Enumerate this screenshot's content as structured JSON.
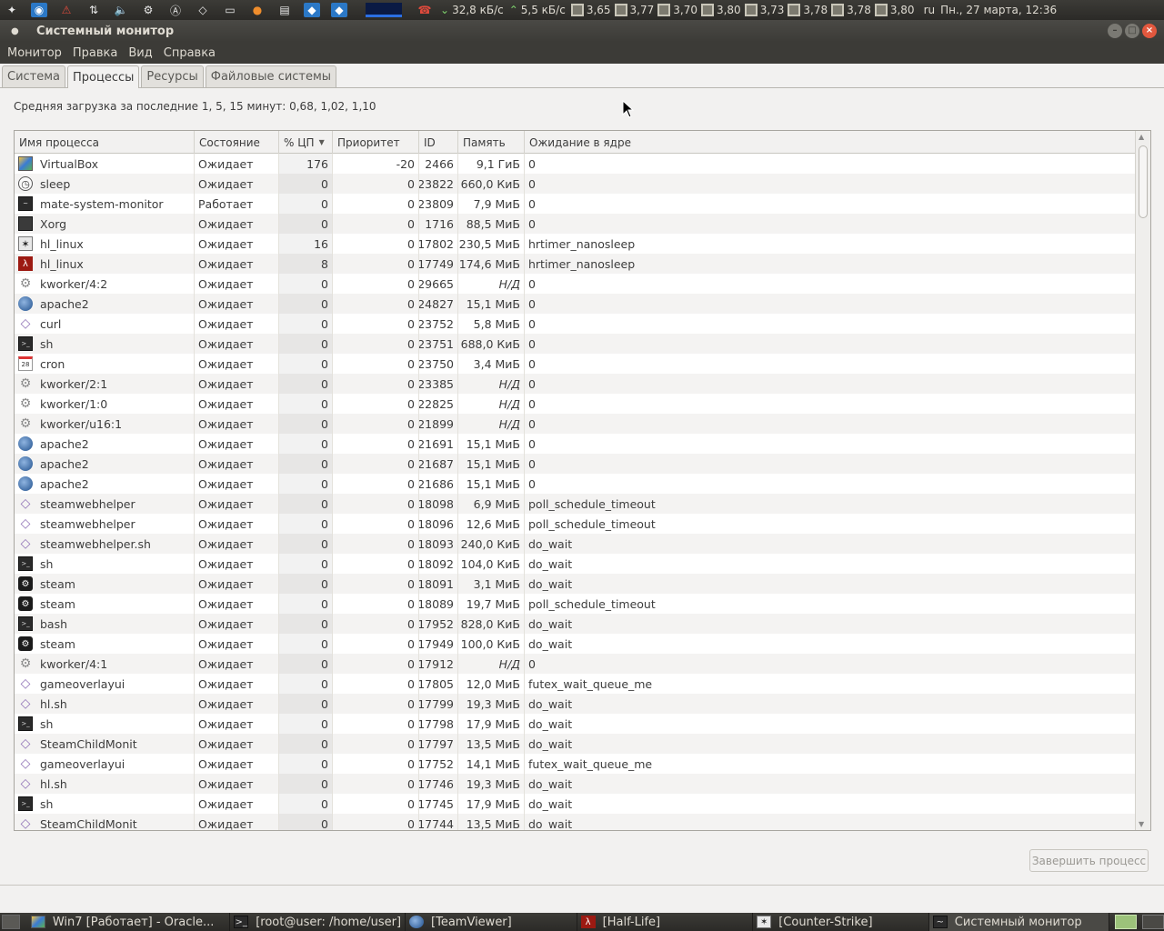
{
  "top_panel": {
    "net_down": "32,8 кБ/с",
    "net_up": "5,5 кБ/с",
    "cpu_freqs": [
      "3,65",
      "3,77",
      "3,70",
      "3,80",
      "3,73",
      "3,78",
      "3,78",
      "3,80"
    ],
    "keyboard_layout": "ru",
    "datetime": "Пн., 27 марта, 12:36"
  },
  "window": {
    "title": "Системный монитор"
  },
  "menu": [
    "Монитор",
    "Правка",
    "Вид",
    "Справка"
  ],
  "tabs": [
    {
      "label": "Система",
      "active": false
    },
    {
      "label": "Процессы",
      "active": true
    },
    {
      "label": "Ресурсы",
      "active": false
    },
    {
      "label": "Файловые системы",
      "active": false
    }
  ],
  "load_avg": "Средняя загрузка за последние 1, 5, 15 минут: 0,68, 1,02, 1,10",
  "table": {
    "columns": [
      "Имя процесса",
      "Состояние",
      "% ЦП",
      "Приоритет",
      "ID",
      "Память",
      "Ожидание в ядре"
    ],
    "sorted_column": "% ЦП",
    "rows": [
      {
        "icon": "virtualbox-icon",
        "name": "VirtualBox",
        "state": "Ожидает",
        "cpu": "176",
        "prio": "-20",
        "id": "2466",
        "mem": "9,1 ГиБ",
        "wait": "0"
      },
      {
        "icon": "clock-icon",
        "name": "sleep",
        "state": "Ожидает",
        "cpu": "0",
        "prio": "0",
        "id": "23822",
        "mem": "660,0 КиБ",
        "wait": "0"
      },
      {
        "icon": "system-monitor-icon",
        "name": "mate-system-monitor",
        "state": "Работает",
        "cpu": "0",
        "prio": "0",
        "id": "23809",
        "mem": "7,9 МиБ",
        "wait": "0"
      },
      {
        "icon": "display-icon",
        "name": "Xorg",
        "state": "Ожидает",
        "cpu": "0",
        "prio": "0",
        "id": "1716",
        "mem": "88,5 МиБ",
        "wait": "0"
      },
      {
        "icon": "counter-strike-icon",
        "name": "hl_linux",
        "state": "Ожидает",
        "cpu": "16",
        "prio": "0",
        "id": "17802",
        "mem": "230,5 МиБ",
        "wait": "hrtimer_nanosleep"
      },
      {
        "icon": "half-life-icon",
        "name": "hl_linux",
        "state": "Ожидает",
        "cpu": "8",
        "prio": "0",
        "id": "17749",
        "mem": "174,6 МиБ",
        "wait": "hrtimer_nanosleep"
      },
      {
        "icon": "gear-icon",
        "name": "kworker/4:2",
        "state": "Ожидает",
        "cpu": "0",
        "prio": "0",
        "id": "29665",
        "mem": "Н/Д",
        "wait": "0"
      },
      {
        "icon": "globe-icon",
        "name": "apache2",
        "state": "Ожидает",
        "cpu": "0",
        "prio": "0",
        "id": "24827",
        "mem": "15,1 МиБ",
        "wait": "0"
      },
      {
        "icon": "diamond-icon",
        "name": "curl",
        "state": "Ожидает",
        "cpu": "0",
        "prio": "0",
        "id": "23752",
        "mem": "5,8 МиБ",
        "wait": "0"
      },
      {
        "icon": "terminal-icon",
        "name": "sh",
        "state": "Ожидает",
        "cpu": "0",
        "prio": "0",
        "id": "23751",
        "mem": "688,0 КиБ",
        "wait": "0"
      },
      {
        "icon": "calendar-icon",
        "name": "cron",
        "state": "Ожидает",
        "cpu": "0",
        "prio": "0",
        "id": "23750",
        "mem": "3,4 МиБ",
        "wait": "0"
      },
      {
        "icon": "gear-icon",
        "name": "kworker/2:1",
        "state": "Ожидает",
        "cpu": "0",
        "prio": "0",
        "id": "23385",
        "mem": "Н/Д",
        "wait": "0"
      },
      {
        "icon": "gear-icon",
        "name": "kworker/1:0",
        "state": "Ожидает",
        "cpu": "0",
        "prio": "0",
        "id": "22825",
        "mem": "Н/Д",
        "wait": "0"
      },
      {
        "icon": "gear-icon",
        "name": "kworker/u16:1",
        "state": "Ожидает",
        "cpu": "0",
        "prio": "0",
        "id": "21899",
        "mem": "Н/Д",
        "wait": "0"
      },
      {
        "icon": "globe-icon",
        "name": "apache2",
        "state": "Ожидает",
        "cpu": "0",
        "prio": "0",
        "id": "21691",
        "mem": "15,1 МиБ",
        "wait": "0"
      },
      {
        "icon": "globe-icon",
        "name": "apache2",
        "state": "Ожидает",
        "cpu": "0",
        "prio": "0",
        "id": "21687",
        "mem": "15,1 МиБ",
        "wait": "0"
      },
      {
        "icon": "globe-icon",
        "name": "apache2",
        "state": "Ожидает",
        "cpu": "0",
        "prio": "0",
        "id": "21686",
        "mem": "15,1 МиБ",
        "wait": "0"
      },
      {
        "icon": "diamond-icon",
        "name": "steamwebhelper",
        "state": "Ожидает",
        "cpu": "0",
        "prio": "0",
        "id": "18098",
        "mem": "6,9 МиБ",
        "wait": "poll_schedule_timeout"
      },
      {
        "icon": "diamond-icon",
        "name": "steamwebhelper",
        "state": "Ожидает",
        "cpu": "0",
        "prio": "0",
        "id": "18096",
        "mem": "12,6 МиБ",
        "wait": "poll_schedule_timeout"
      },
      {
        "icon": "diamond-icon",
        "name": "steamwebhelper.sh",
        "state": "Ожидает",
        "cpu": "0",
        "prio": "0",
        "id": "18093",
        "mem": "240,0 КиБ",
        "wait": "do_wait"
      },
      {
        "icon": "terminal-icon",
        "name": "sh",
        "state": "Ожидает",
        "cpu": "0",
        "prio": "0",
        "id": "18092",
        "mem": "104,0 КиБ",
        "wait": "do_wait"
      },
      {
        "icon": "steam-icon",
        "name": "steam",
        "state": "Ожидает",
        "cpu": "0",
        "prio": "0",
        "id": "18091",
        "mem": "3,1 МиБ",
        "wait": "do_wait"
      },
      {
        "icon": "steam-icon",
        "name": "steam",
        "state": "Ожидает",
        "cpu": "0",
        "prio": "0",
        "id": "18089",
        "mem": "19,7 МиБ",
        "wait": "poll_schedule_timeout"
      },
      {
        "icon": "terminal-icon",
        "name": "bash",
        "state": "Ожидает",
        "cpu": "0",
        "prio": "0",
        "id": "17952",
        "mem": "828,0 КиБ",
        "wait": "do_wait"
      },
      {
        "icon": "steam-icon",
        "name": "steam",
        "state": "Ожидает",
        "cpu": "0",
        "prio": "0",
        "id": "17949",
        "mem": "100,0 КиБ",
        "wait": "do_wait"
      },
      {
        "icon": "gear-icon",
        "name": "kworker/4:1",
        "state": "Ожидает",
        "cpu": "0",
        "prio": "0",
        "id": "17912",
        "mem": "Н/Д",
        "wait": "0"
      },
      {
        "icon": "diamond-icon",
        "name": "gameoverlayui",
        "state": "Ожидает",
        "cpu": "0",
        "prio": "0",
        "id": "17805",
        "mem": "12,0 МиБ",
        "wait": "futex_wait_queue_me"
      },
      {
        "icon": "diamond-icon",
        "name": "hl.sh",
        "state": "Ожидает",
        "cpu": "0",
        "prio": "0",
        "id": "17799",
        "mem": "19,3 МиБ",
        "wait": "do_wait"
      },
      {
        "icon": "terminal-icon",
        "name": "sh",
        "state": "Ожидает",
        "cpu": "0",
        "prio": "0",
        "id": "17798",
        "mem": "17,9 МиБ",
        "wait": "do_wait"
      },
      {
        "icon": "diamond-icon",
        "name": "SteamChildMonit",
        "state": "Ожидает",
        "cpu": "0",
        "prio": "0",
        "id": "17797",
        "mem": "13,5 МиБ",
        "wait": "do_wait"
      },
      {
        "icon": "diamond-icon",
        "name": "gameoverlayui",
        "state": "Ожидает",
        "cpu": "0",
        "prio": "0",
        "id": "17752",
        "mem": "14,1 МиБ",
        "wait": "futex_wait_queue_me"
      },
      {
        "icon": "diamond-icon",
        "name": "hl.sh",
        "state": "Ожидает",
        "cpu": "0",
        "prio": "0",
        "id": "17746",
        "mem": "19,3 МиБ",
        "wait": "do_wait"
      },
      {
        "icon": "terminal-icon",
        "name": "sh",
        "state": "Ожидает",
        "cpu": "0",
        "prio": "0",
        "id": "17745",
        "mem": "17,9 МиБ",
        "wait": "do_wait"
      },
      {
        "icon": "diamond-icon",
        "name": "SteamChildMonit",
        "state": "Ожидает",
        "cpu": "0",
        "prio": "0",
        "id": "17744",
        "mem": "13,5 МиБ",
        "wait": "do_wait"
      }
    ]
  },
  "end_process_label": "Завершить процесс",
  "taskbar": [
    {
      "icon": "virtualbox-icon",
      "label": "Win7 [Работает] - Oracle..."
    },
    {
      "icon": "terminal-icon",
      "label": "[root@user: /home/user]"
    },
    {
      "icon": "teamviewer-icon",
      "label": "[TeamViewer]"
    },
    {
      "icon": "half-life-icon",
      "label": "[Half-Life]"
    },
    {
      "icon": "counter-strike-icon",
      "label": "[Counter-Strike]"
    },
    {
      "icon": "system-monitor-icon",
      "label": "Системный монитор",
      "active": true
    }
  ]
}
